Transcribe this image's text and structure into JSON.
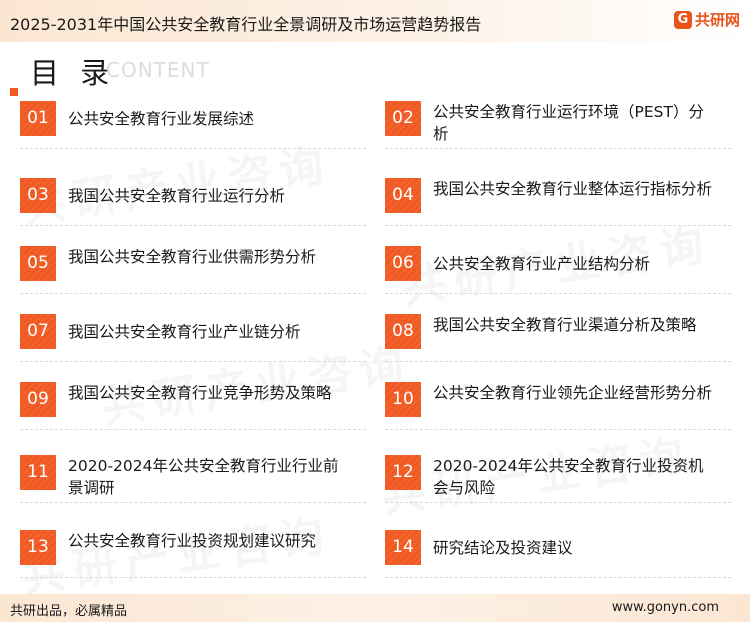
{
  "header": {
    "title": "2025-2031年中国公共安全教育行业全景调研及市场运营趋势报告",
    "brand": "共研网",
    "brand_icon": "G"
  },
  "toc": {
    "heading": "目 录",
    "subheading": "CONTENT"
  },
  "watermark": {
    "text": "共研产业咨询",
    "url": "www.gonyn.com"
  },
  "items": [
    {
      "num": "01",
      "label": "公共安全教育行业发展综述"
    },
    {
      "num": "02",
      "label": "公共安全教育行业运行环境（PEST）分析"
    },
    {
      "num": "03",
      "label": "我国公共安全教育行业运行分析"
    },
    {
      "num": "04",
      "label": "我国公共安全教育行业整体运行指标分析"
    },
    {
      "num": "05",
      "label": "我国公共安全教育行业供需形势分析"
    },
    {
      "num": "06",
      "label": "公共安全教育行业产业结构分析"
    },
    {
      "num": "07",
      "label": "我国公共安全教育行业产业链分析"
    },
    {
      "num": "08",
      "label": "我国公共安全教育行业渠道分析及策略"
    },
    {
      "num": "09",
      "label": "我国公共安全教育行业竞争形势及策略"
    },
    {
      "num": "10",
      "label": "公共安全教育行业领先企业经营形势分析"
    },
    {
      "num": "11",
      "label": "2020-2024年公共安全教育行业行业前景调研"
    },
    {
      "num": "12",
      "label": "2020-2024年公共安全教育行业投资机会与风险"
    },
    {
      "num": "13",
      "label": "公共安全教育行业投资规划建议研究"
    },
    {
      "num": "14",
      "label": "研究结论及投资建议"
    }
  ],
  "footer": {
    "slogan": "共研出品，必属精品",
    "website": "www.gonyn.com"
  },
  "colors": {
    "accent": "#f05a22",
    "header_bg": "#fbe6d2"
  }
}
